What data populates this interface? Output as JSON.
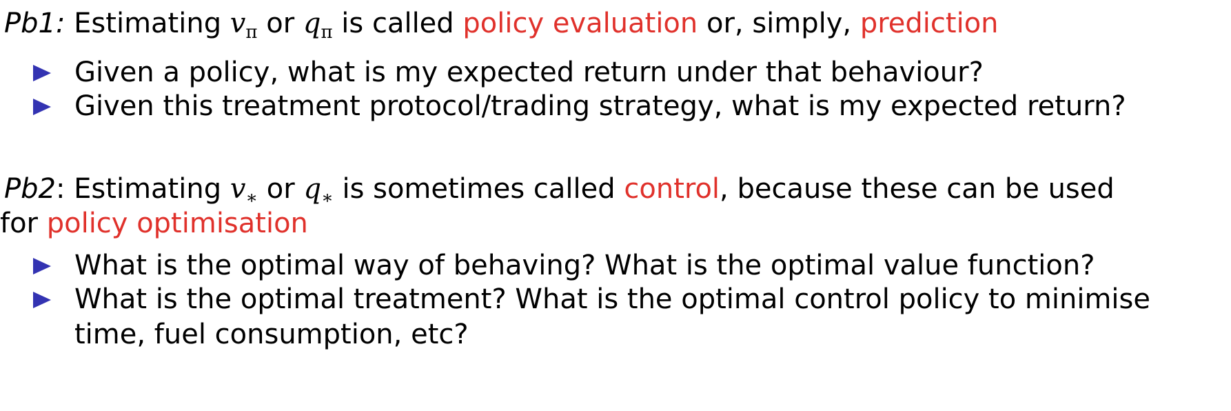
{
  "pb1": {
    "label": "Pb1:",
    "text_1": " Estimating ",
    "var_1": "v",
    "sub_1": "π",
    "text_2": " or ",
    "var_2": "q",
    "sub_2": "π",
    "text_3": " is called ",
    "highlight_1": "policy evaluation",
    "text_4": " or, simply, ",
    "highlight_2": "prediction",
    "bullets": [
      "Given a policy, what is my expected return under that behaviour?",
      "Given this treatment protocol/trading strategy, what is my expected return?"
    ]
  },
  "pb2": {
    "label": "Pb2",
    "text_1": ": Estimating ",
    "var_1": "v",
    "sub_1": "∗",
    "text_2": " or ",
    "var_2": "q",
    "sub_2": "∗",
    "text_3": " is sometimes called ",
    "highlight_1": "control",
    "text_4": ", because these can be used",
    "line2_text": "for ",
    "highlight_2": "policy optimisation",
    "bullets": [
      "What is the optimal way of behaving? What is the optimal value function?",
      "What is the optimal treatment? What is the optimal control policy to minimise"
    ],
    "bullet_2_cont": "time, fuel consumption, etc?"
  },
  "colors": {
    "highlight": "#e0312b",
    "bullet": "#3333b2",
    "text": "#000000"
  },
  "icons": {
    "bullet": "blue-triangle-bullet-icon"
  }
}
